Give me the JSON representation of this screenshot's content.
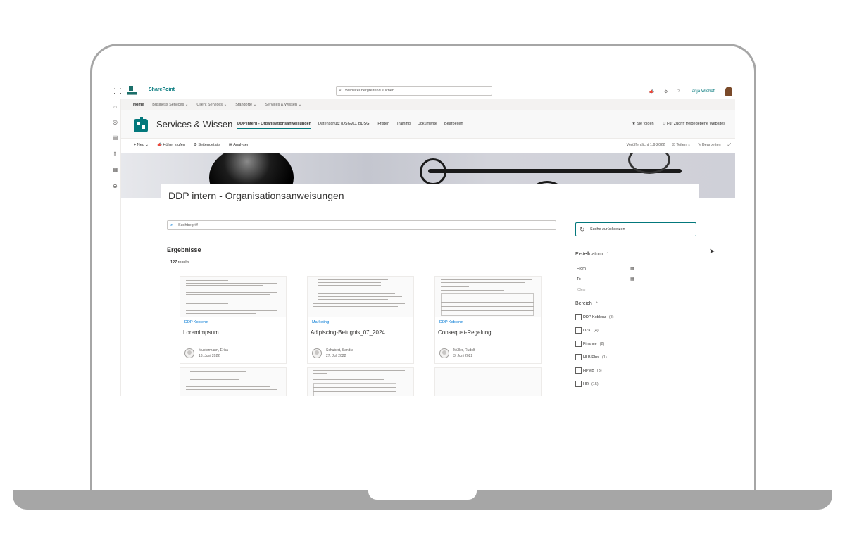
{
  "suite": {
    "app_name": "SharePoint",
    "search_placeholder": "Websiteübergreifend suchen",
    "user_name": "Tanja Wiehoff",
    "help_label": "?"
  },
  "hub_nav": {
    "home": "Home",
    "items": [
      "Business Services",
      "Client Services",
      "Standorte",
      "Services & Wissen"
    ]
  },
  "site": {
    "title": "Services & Wissen",
    "nav": [
      "DDP intern - Organisationsanweisungen",
      "Datenschutz (DSGVO, BDSG)",
      "Fristen",
      "Training",
      "Dokumente",
      "Bearbeiten"
    ],
    "follow_label": "Sie folgen",
    "shared_label": "Für Zugriff freigegebene Websites"
  },
  "commands": {
    "new": "Neu",
    "promote": "Höher stufen",
    "page_details": "Seitendetails",
    "analytics": "Analysen",
    "published": "Veröffentlicht 1.9.2022",
    "share": "Teilen",
    "edit": "Bearbeiten"
  },
  "page": {
    "title": "DDP intern - Organisationsanweisungen",
    "search_placeholder": "Suchbegriff",
    "reset_label": "Suche zurücksetzen",
    "results_heading": "Ergebnisse",
    "results_count": "127",
    "results_suffix": "results"
  },
  "cards": [
    {
      "tag": "DDP Koblenz",
      "title": "Loremimpsum",
      "author": "Mustermann, Erika",
      "date": "13. Juni 2022"
    },
    {
      "tag": "Marketing",
      "title": "Adipiscing-Befugnis_07_2024",
      "author": "Schubert, Sandra",
      "date": "27. Juli 2022"
    },
    {
      "tag": "DDP Koblenz",
      "title": "Consequat-Regelung",
      "author": "Müller, Rudolf",
      "date": "3. Juni 2022"
    }
  ],
  "filters": {
    "date_heading": "Erstelldatum",
    "from_label": "From",
    "to_label": "To",
    "clear_label": "Clear",
    "area_heading": "Bereich",
    "areas": [
      {
        "label": "DDP Koblenz",
        "count": "(8)"
      },
      {
        "label": "DZK",
        "count": "(4)"
      },
      {
        "label": "Finance",
        "count": "(2)"
      },
      {
        "label": "HLB Plus",
        "count": "(1)"
      },
      {
        "label": "HPMB",
        "count": "(3)"
      },
      {
        "label": "HR",
        "count": "(15)"
      }
    ]
  },
  "colors": {
    "accent": "#03787c",
    "link": "#0078d4",
    "bezel": "#a6a6a6"
  }
}
